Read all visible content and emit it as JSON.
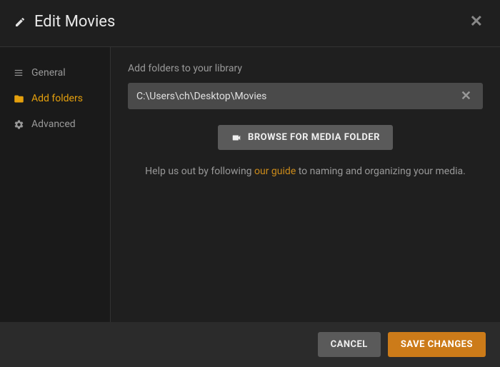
{
  "header": {
    "title": "Edit Movies"
  },
  "sidebar": {
    "items": [
      {
        "label": "General"
      },
      {
        "label": "Add folders"
      },
      {
        "label": "Advanced"
      }
    ]
  },
  "content": {
    "section_label": "Add folders to your library",
    "folder_path": "C:\\Users\\ch\\Desktop\\Movies",
    "browse_label": "BROWSE FOR MEDIA FOLDER",
    "help_prefix": "Help us out by following ",
    "help_link": "our guide",
    "help_suffix": " to naming and organizing your media."
  },
  "footer": {
    "cancel_label": "CANCEL",
    "save_label": "SAVE CHANGES"
  }
}
